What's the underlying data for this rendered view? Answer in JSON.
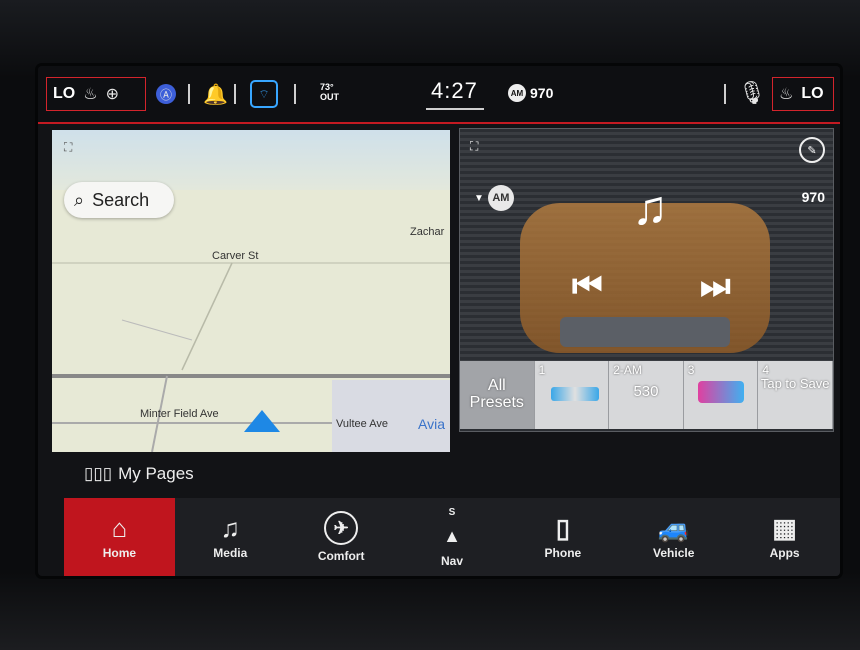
{
  "status_bar": {
    "left_fan_level": "LO",
    "right_fan_level": "LO",
    "temperature": "73°",
    "temperature_unit": "OUT",
    "time": "4:27",
    "radio_badge": "AM",
    "radio_frequency": "970"
  },
  "map": {
    "search_label": "Search",
    "streets": [
      "Carver St",
      "Zachar",
      "Minter Field Ave",
      "Vultee Ave"
    ],
    "poi": "Avia"
  },
  "radio": {
    "band": "AM",
    "frequency": "970",
    "presets": [
      {
        "number": "",
        "label": "All Presets"
      },
      {
        "number": "1",
        "label": ""
      },
      {
        "number": "2-AM",
        "label": "530"
      },
      {
        "number": "3",
        "label": ""
      },
      {
        "number": "4",
        "label": "Tap to Save"
      }
    ]
  },
  "my_pages_label": "My Pages",
  "nav": [
    {
      "label": "Home",
      "icon": "home-icon",
      "active": true
    },
    {
      "label": "Media",
      "icon": "music-note-icon",
      "active": false
    },
    {
      "label": "Comfort",
      "icon": "seat-icon",
      "active": false
    },
    {
      "label": "Nav",
      "icon": "compass-icon",
      "active": false
    },
    {
      "label": "Phone",
      "icon": "phone-icon",
      "active": false
    },
    {
      "label": "Vehicle",
      "icon": "car-icon",
      "active": false
    },
    {
      "label": "Apps",
      "icon": "grid-icon",
      "active": false
    }
  ],
  "nav_compass": "S"
}
